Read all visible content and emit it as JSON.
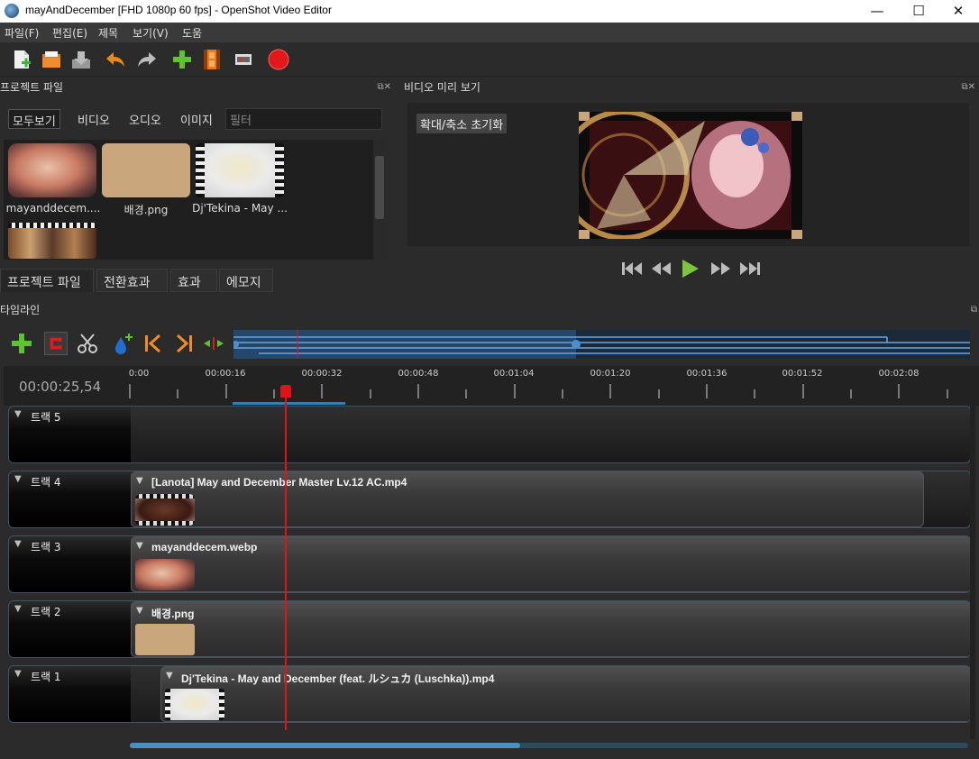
{
  "window": {
    "title": "mayAndDecember [FHD 1080p 60 fps] - OpenShot Video Editor",
    "minimize": "—",
    "maximize": "☐",
    "close": "✕"
  },
  "menu": [
    "파일(F)",
    "편집(E)",
    "제목",
    "보기(V)",
    "도움"
  ],
  "toolbar": {
    "icons": [
      "new-project-icon",
      "open-project-icon",
      "save-project-icon",
      "undo-icon",
      "redo-icon",
      "import-files-icon",
      "choose-profile-icon",
      "fullscreen-icon",
      "export-video-icon"
    ]
  },
  "project_files": {
    "title": "프로젝트 파일",
    "filters": [
      "모두보기",
      "비디오",
      "오디오",
      "이미지"
    ],
    "filter_placeholder": "필터",
    "files": [
      {
        "label": "mayanddecem...."
      },
      {
        "label": "배경.png"
      },
      {
        "label": "Dj'Tekina - May ..."
      },
      {
        "label": ""
      }
    ]
  },
  "tabs": [
    "프로젝트 파일",
    "전환효과",
    "효과",
    "에모지"
  ],
  "preview": {
    "title": "비디오 미리 보기",
    "zoom_reset": "확대/축소 초기화"
  },
  "timeline": {
    "title": "타임라인",
    "current_time": "00:00:25,54",
    "ticks": [
      "0:00",
      "00:00:16",
      "00:00:32",
      "00:00:48",
      "00:01:04",
      "00:01:20",
      "00:01:36",
      "00:01:52",
      "00:02:08"
    ],
    "tracks": [
      {
        "name": "트랙 5",
        "clip": null
      },
      {
        "name": "트랙 4",
        "clip": "[Lanota] May and December Master Lv.12 AC.mp4"
      },
      {
        "name": "트랙 3",
        "clip": "mayanddecem.webp"
      },
      {
        "name": "트랙 2",
        "clip": "배경.png"
      },
      {
        "name": "트랙 1",
        "clip": "Dj'Tekina - May and December (feat. ルシュカ (Luschka)).mp4"
      }
    ]
  },
  "colors": {
    "playhead": "#e0121a",
    "accent": "#4a90b8",
    "record": "#e3181b"
  }
}
